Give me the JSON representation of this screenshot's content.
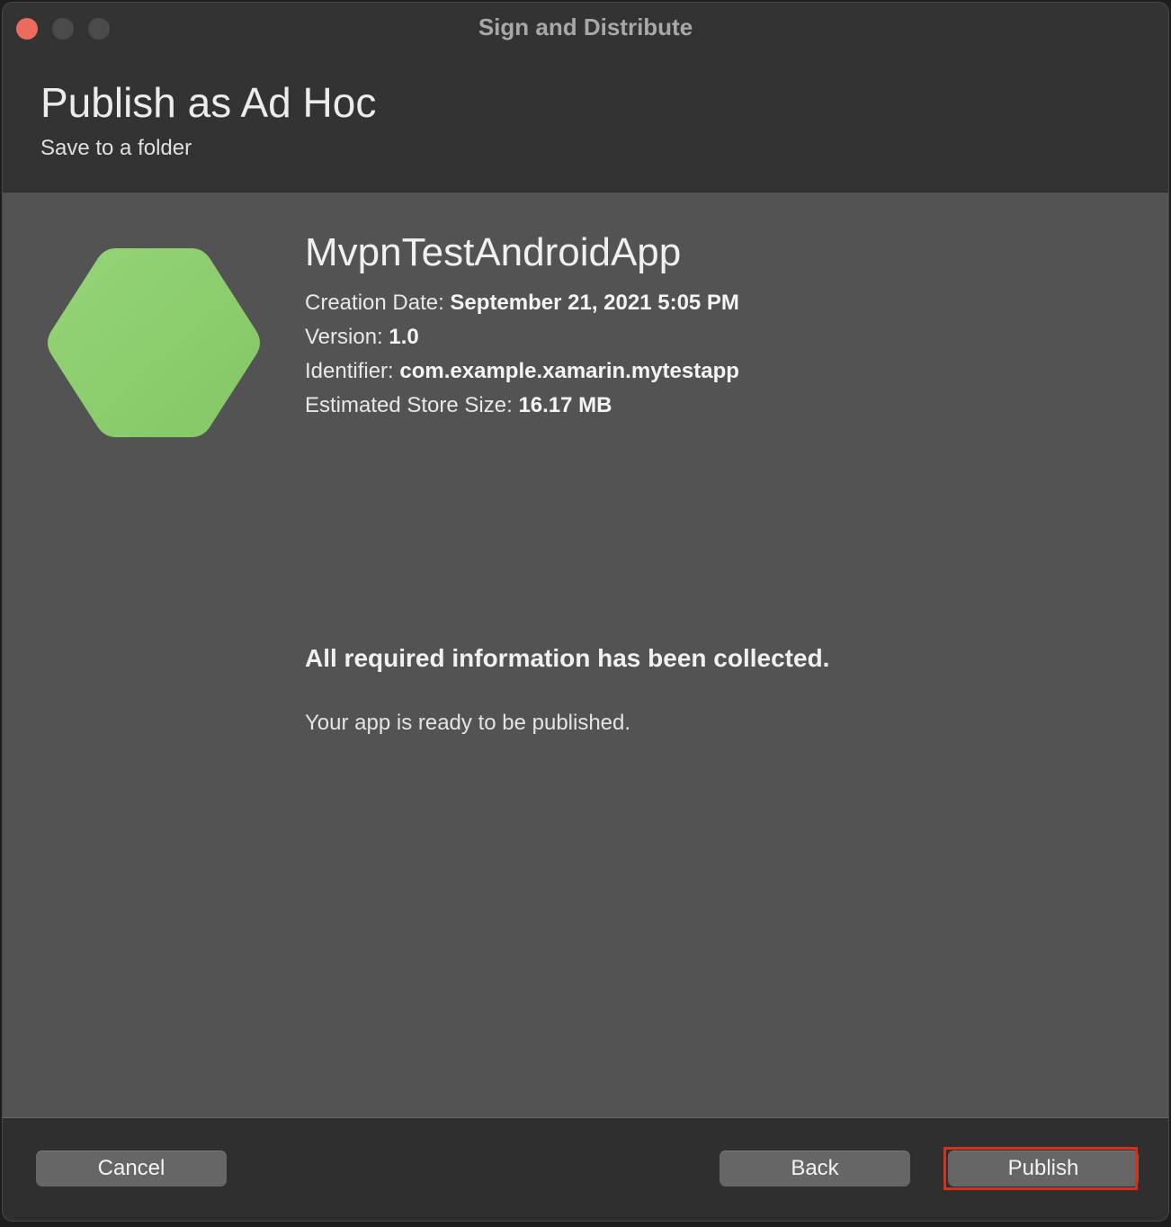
{
  "window": {
    "title": "Sign and Distribute"
  },
  "header": {
    "title": "Publish as Ad Hoc",
    "subtitle": "Save to a folder"
  },
  "app": {
    "icon": "hexagon-app-icon",
    "icon_color": "#8ccc6c",
    "name": "MvpnTestAndroidApp",
    "creation_date_label": "Creation Date:",
    "creation_date": "September 21, 2021 5:05 PM",
    "version_label": "Version:",
    "version": "1.0",
    "identifier_label": "Identifier:",
    "identifier": "com.example.xamarin.mytestapp",
    "size_label": "Estimated Store Size:",
    "size": "16.17 MB"
  },
  "status": {
    "title": "All required information has been collected.",
    "message": "Your app is ready to be published."
  },
  "footer": {
    "cancel_label": "Cancel",
    "back_label": "Back",
    "publish_label": "Publish",
    "highlight_color": "#d9301c"
  }
}
